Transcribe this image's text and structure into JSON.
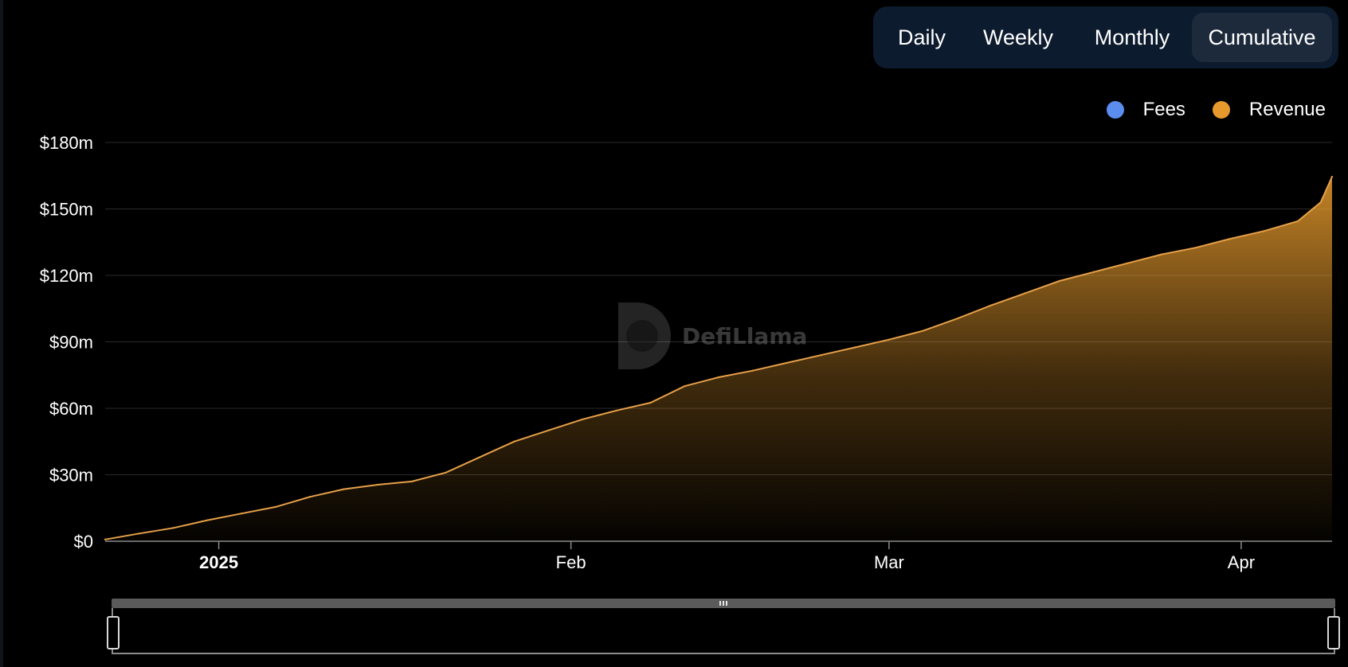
{
  "toggles": {
    "items": [
      {
        "label": "Daily",
        "active": false
      },
      {
        "label": "Weekly",
        "active": false
      },
      {
        "label": "Monthly",
        "active": false
      },
      {
        "label": "Cumulative",
        "active": true
      }
    ]
  },
  "legend": {
    "items": [
      {
        "label": "Fees",
        "color": "#5b8def"
      },
      {
        "label": "Revenue",
        "color": "#e69a2d"
      }
    ]
  },
  "watermark": {
    "text": "DefiLlama",
    "icon": "defillama-logo-icon"
  },
  "chart_data": {
    "type": "area",
    "title": "",
    "xlabel": "",
    "ylabel": "",
    "xlim": [
      "2024-12-22",
      "2025-04-09"
    ],
    "ylim": [
      0,
      180
    ],
    "x_ticks": [
      {
        "date": "2025-01-01",
        "label": "2025",
        "bold": true
      },
      {
        "date": "2025-02-01",
        "label": "Feb",
        "bold": false
      },
      {
        "date": "2025-03-01",
        "label": "Mar",
        "bold": false
      },
      {
        "date": "2025-04-01",
        "label": "Apr",
        "bold": false
      }
    ],
    "y_ticks": [
      {
        "value": 0,
        "label": "$0"
      },
      {
        "value": 30,
        "label": "$30m"
      },
      {
        "value": 60,
        "label": "$60m"
      },
      {
        "value": 90,
        "label": "$90m"
      },
      {
        "value": 120,
        "label": "$120m"
      },
      {
        "value": 150,
        "label": "$150m"
      },
      {
        "value": 180,
        "label": "$180m"
      }
    ],
    "grid": true,
    "legend_position": "top-right",
    "series": [
      {
        "name": "Revenue",
        "color": "#e69a2d",
        "points": [
          [
            "2024-12-22",
            0.8
          ],
          [
            "2024-12-25",
            3.5
          ],
          [
            "2024-12-28",
            6.0
          ],
          [
            "2024-12-31",
            9.5
          ],
          [
            "2025-01-03",
            12.5
          ],
          [
            "2025-01-06",
            15.5
          ],
          [
            "2025-01-09",
            20.0
          ],
          [
            "2025-01-12",
            23.5
          ],
          [
            "2025-01-15",
            25.5
          ],
          [
            "2025-01-18",
            27.0
          ],
          [
            "2025-01-21",
            31.0
          ],
          [
            "2025-01-24",
            38.0
          ],
          [
            "2025-01-27",
            45.0
          ],
          [
            "2025-01-30",
            50.0
          ],
          [
            "2025-02-02",
            55.0
          ],
          [
            "2025-02-05",
            59.0
          ],
          [
            "2025-02-08",
            62.5
          ],
          [
            "2025-02-11",
            70.0
          ],
          [
            "2025-02-14",
            74.0
          ],
          [
            "2025-02-17",
            77.0
          ],
          [
            "2025-02-20",
            80.5
          ],
          [
            "2025-02-23",
            84.0
          ],
          [
            "2025-02-26",
            87.5
          ],
          [
            "2025-03-01",
            91.0
          ],
          [
            "2025-03-04",
            95.0
          ],
          [
            "2025-03-07",
            100.5
          ],
          [
            "2025-03-10",
            106.5
          ],
          [
            "2025-03-13",
            112.0
          ],
          [
            "2025-03-16",
            117.5
          ],
          [
            "2025-03-19",
            121.5
          ],
          [
            "2025-03-22",
            125.5
          ],
          [
            "2025-03-25",
            129.5
          ],
          [
            "2025-03-28",
            132.5
          ],
          [
            "2025-03-31",
            136.5
          ],
          [
            "2025-04-03",
            140.0
          ],
          [
            "2025-04-06",
            144.5
          ],
          [
            "2025-04-08",
            153.0
          ],
          [
            "2025-04-09",
            164.5
          ]
        ]
      }
    ]
  }
}
